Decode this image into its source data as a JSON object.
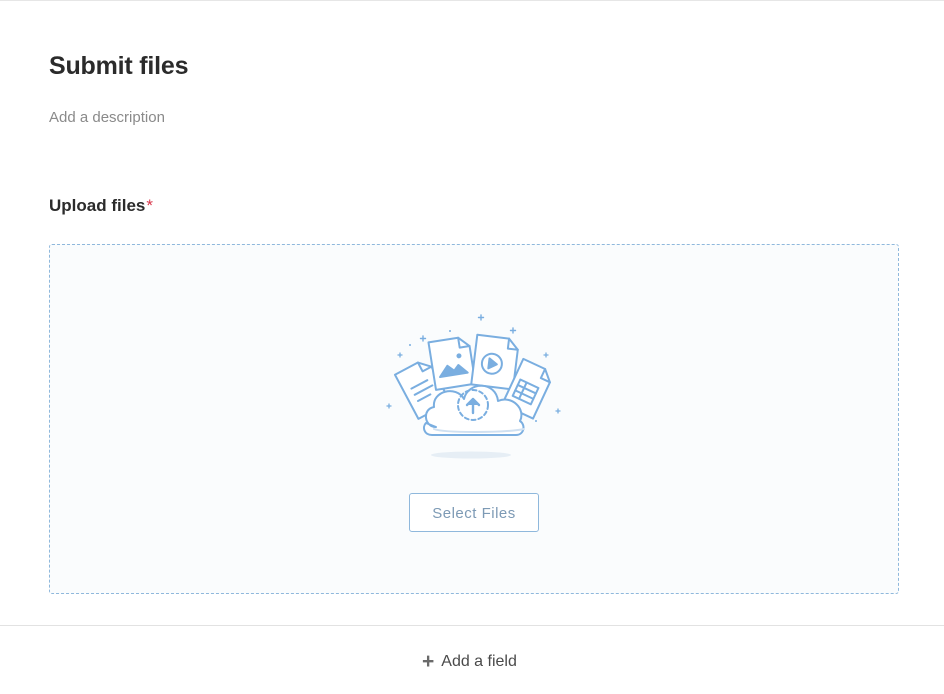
{
  "form": {
    "title": "Submit files",
    "description_placeholder": "Add a description"
  },
  "upload_field": {
    "label": "Upload files",
    "required_marker": "*",
    "illustration_icon": "cloud-upload-files-illustration",
    "select_button_label": "Select Files"
  },
  "footer": {
    "add_field_icon": "plus-icon",
    "add_field_label": "Add a field"
  },
  "colors": {
    "title_text": "#2b2b2b",
    "muted_text": "#8a8a8a",
    "required_red": "#d8364a",
    "dropzone_border": "#8fb8dc",
    "dropzone_bg": "#fafcfd",
    "illustration_blue": "#7aaee0",
    "button_text": "#7d9ab5"
  }
}
